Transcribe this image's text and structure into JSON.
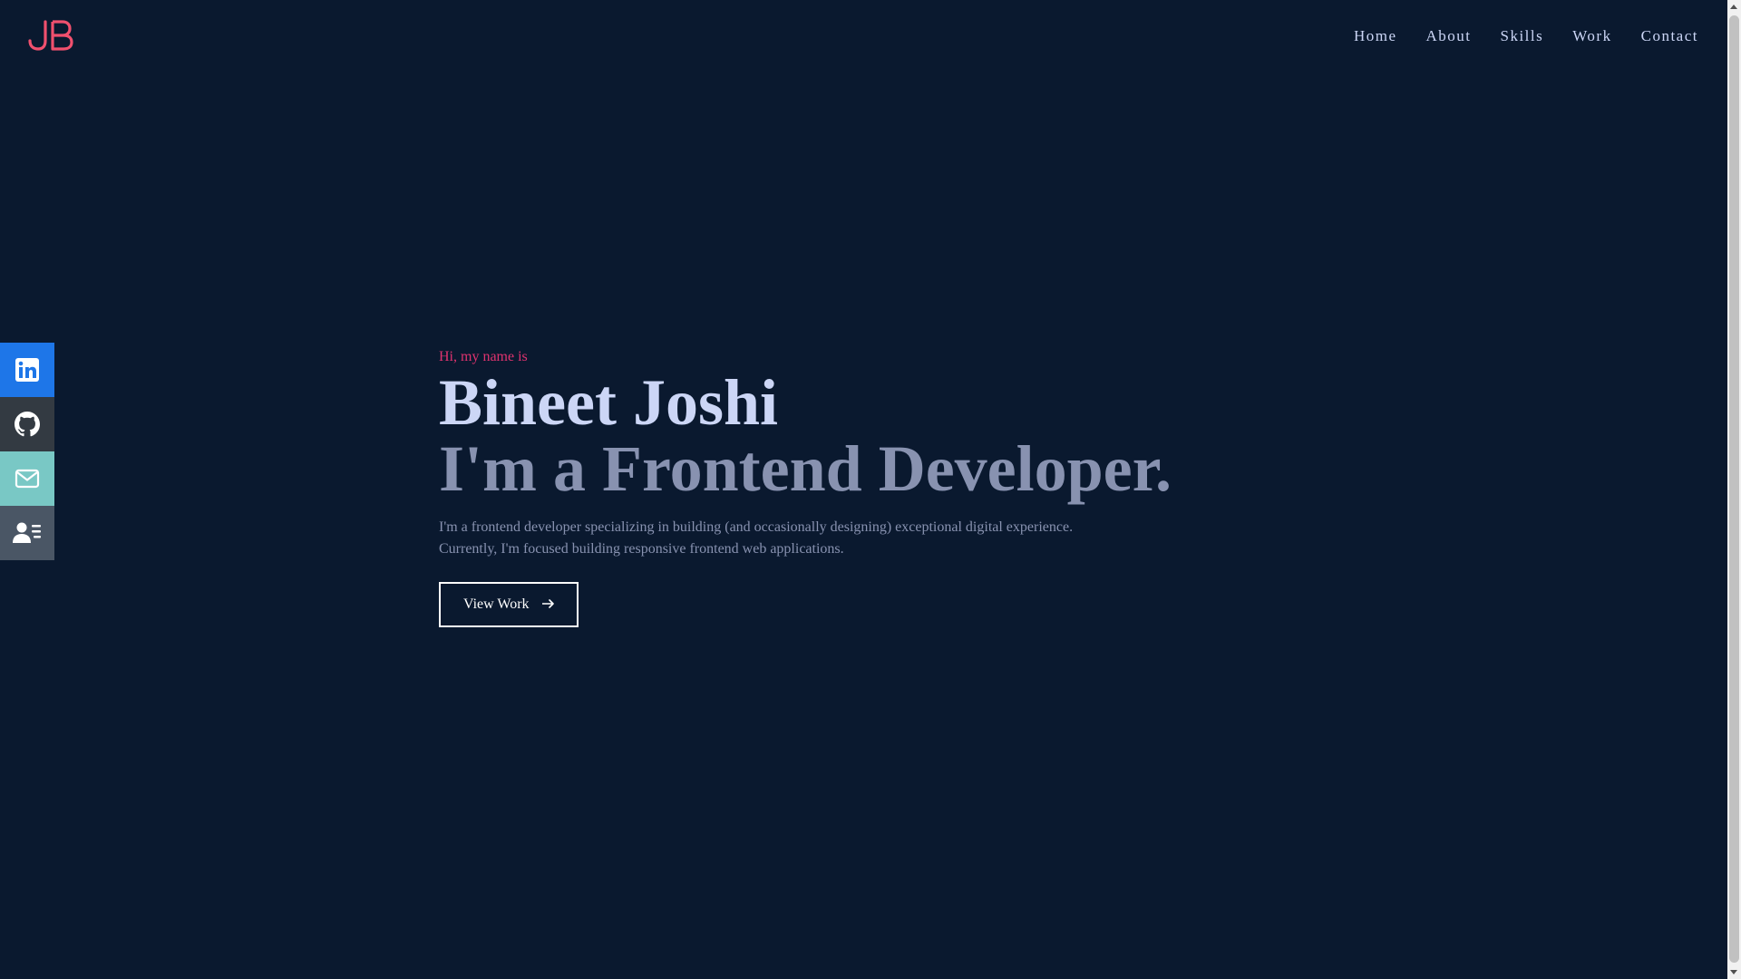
{
  "logo": {
    "text": "JB",
    "color": "#f0506e"
  },
  "nav": {
    "items": [
      "Home",
      "About",
      "Skills",
      "Work",
      "Contact"
    ]
  },
  "social": {
    "items": [
      {
        "icon": "linkedin-icon",
        "color": "#1e76e8"
      },
      {
        "icon": "github-icon",
        "color": "#333a42"
      },
      {
        "icon": "mail-icon",
        "color": "#79c8c5"
      },
      {
        "icon": "resume-icon",
        "color": "#4a5665"
      }
    ]
  },
  "hero": {
    "greeting": "Hi, my name is",
    "name": "Bineet Joshi",
    "role": "I'm a Frontend Developer.",
    "description_line1": "I'm a frontend developer specializing in building (and occasionally designing) exceptional digital experience.",
    "description_line2": "Currently, I'm focused building responsive frontend web applications.",
    "cta_label": "View Work",
    "cta_icon": "arrow-right-icon"
  },
  "colors": {
    "background": "#0a192f",
    "accent": "#e0336f",
    "heading": "#ccd6f6",
    "muted": "#8892b0"
  }
}
